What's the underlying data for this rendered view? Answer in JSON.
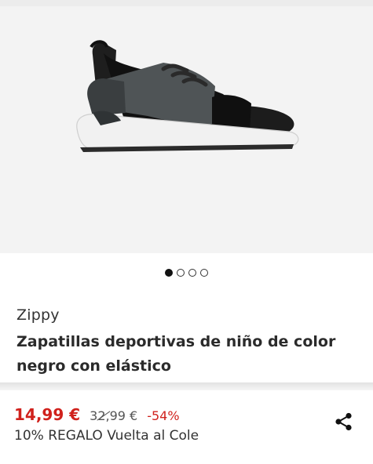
{
  "product": {
    "image_alt": "shoe-image",
    "gallery": {
      "image_count": 4,
      "active_index": 0
    },
    "brand": "Zippy",
    "title": "Zapatillas deportivas de niño de color negro con elástico"
  },
  "pricing": {
    "current": "14,99 €",
    "original": "32,99 €",
    "discount": "-54%",
    "promo": "10% REGALO Vuelta al Cole"
  },
  "icons": {
    "share": "share-icon"
  },
  "colors": {
    "price": "#d0211c",
    "background": "#ffffff",
    "gallery_bg": "#f3f3f3"
  }
}
